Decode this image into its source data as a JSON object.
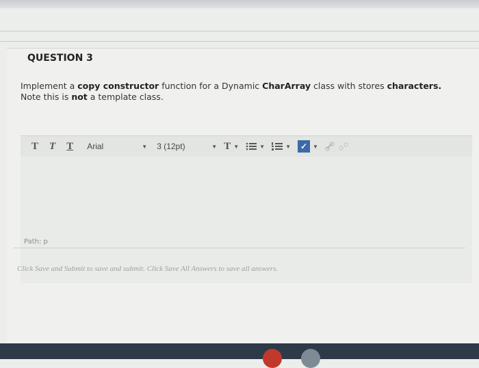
{
  "question": {
    "title": "QUESTION 3",
    "text_parts": {
      "p1": "Implement a ",
      "p2": "copy constructor",
      "p3": " function for a Dynamic ",
      "p4": "CharArray",
      "p5": " class with stores ",
      "p6": "characters.",
      "p7": "Note this is ",
      "p8": "not",
      "p9": " a template class."
    }
  },
  "toolbar": {
    "bold_glyph": "T",
    "italic_glyph": "T",
    "underline_glyph": "T",
    "font_value": "Arial",
    "size_value": "3 (12pt)",
    "text_color_glyph": "T"
  },
  "editor": {
    "path_label": "Path: p"
  },
  "footer": {
    "hint": "Click Save and Submit to save and submit. Click Save All Answers to save all answers."
  },
  "colors": {
    "spellcheck": "#3c6aa8",
    "taskbar": "#2f3a48",
    "taskbar_circle_1": "#c0392b",
    "taskbar_circle_2": "#7e8b97"
  }
}
